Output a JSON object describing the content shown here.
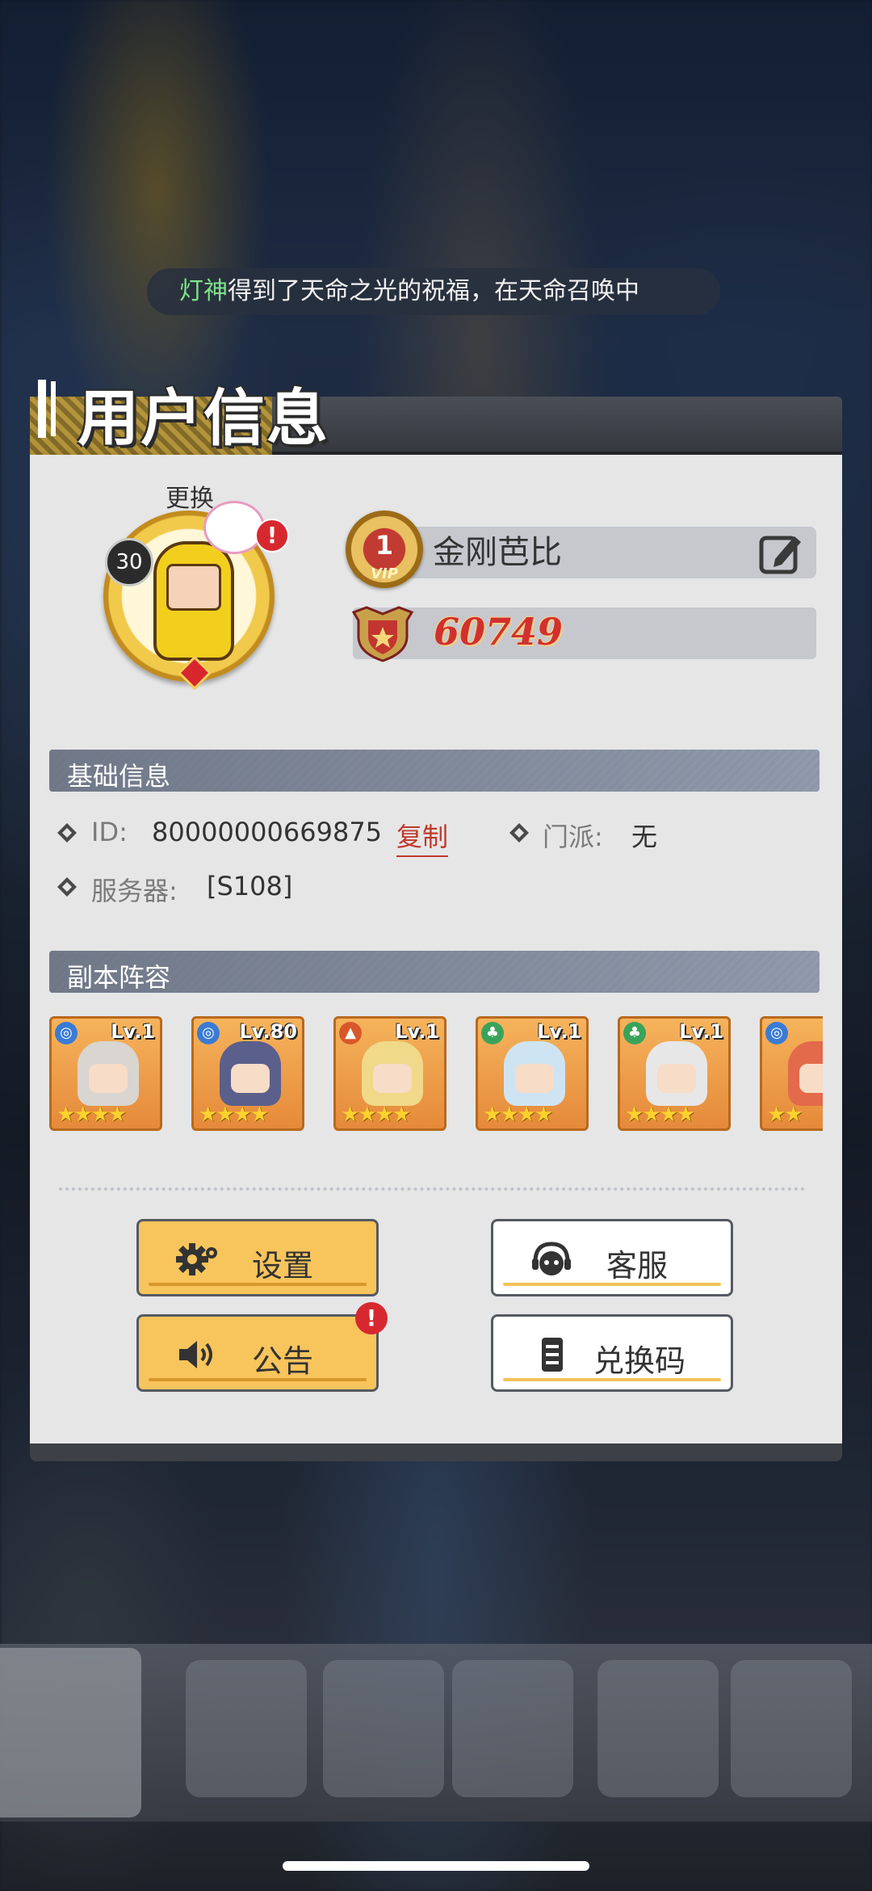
{
  "marquee": {
    "player": "灯神",
    "message": "得到了天命之光的祝福，在天命召唤中"
  },
  "panel": {
    "title": "用户信息"
  },
  "profile": {
    "change_label": "更换",
    "avatar_level": "30",
    "alert": "!",
    "vip_level": "1",
    "vip_text": "VIP",
    "name": "金刚芭比",
    "power": "60749",
    "icons": [
      "edit-icon",
      "shield-power-icon"
    ]
  },
  "basic_info": {
    "header": "基础信息",
    "id_label": "ID:",
    "id_value": "80000000669875",
    "copy_label": "复制",
    "faction_label": "门派:",
    "faction_value": "无",
    "server_label": "服务器:",
    "server_value": "[S108]"
  },
  "lineup": {
    "header": "副本阵容",
    "heroes": [
      {
        "level": "Lv.1",
        "element": "water",
        "element_color": "#3a7bd5",
        "stars": 4
      },
      {
        "level": "Lv.80",
        "element": "water",
        "element_color": "#3a7bd5",
        "stars": 4
      },
      {
        "level": "Lv.1",
        "element": "fire",
        "element_color": "#d8572a",
        "stars": 4
      },
      {
        "level": "Lv.1",
        "element": "wood",
        "element_color": "#3aa35a",
        "stars": 4
      },
      {
        "level": "Lv.1",
        "element": "wood",
        "element_color": "#3aa35a",
        "stars": 4
      },
      {
        "level": "",
        "element": "water",
        "element_color": "#3a7bd5",
        "stars": 2
      }
    ]
  },
  "buttons": {
    "settings": "设置",
    "support": "客服",
    "notice": "公告",
    "redeem": "兑换码",
    "notice_alert": "!"
  },
  "colors": {
    "accent_yellow": "#f8c45c",
    "alert_red": "#d7282f",
    "power_red": "#d2302f",
    "panel_bg": "#e6e6e7"
  }
}
